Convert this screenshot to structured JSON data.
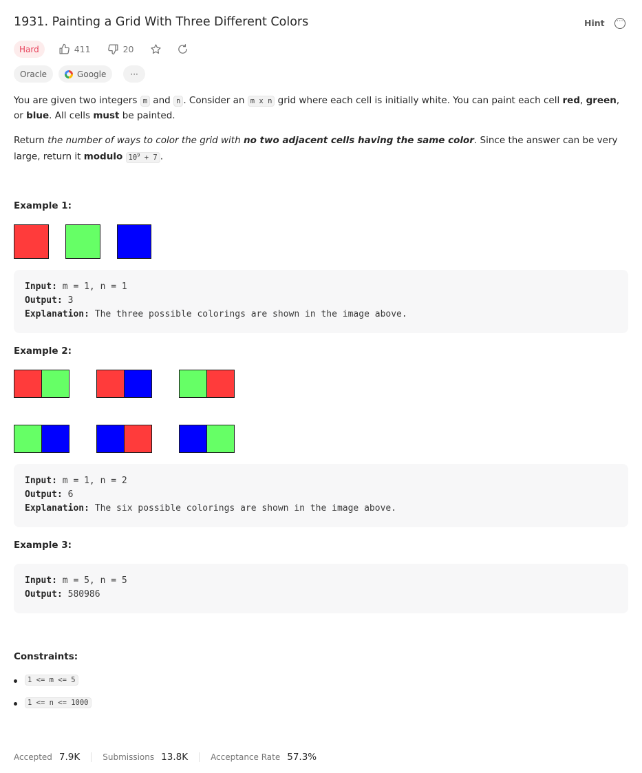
{
  "problem": {
    "title": "1931. Painting a Grid With Three Different Colors",
    "hint_label": "Hint",
    "more_label": "···",
    "difficulty": "Hard",
    "likes": "411",
    "dislikes": "20",
    "companies": [
      "Oracle",
      "Google"
    ],
    "companies_more": "···"
  },
  "description": {
    "p1_a": "You are given two integers ",
    "p1_m": "m",
    "p1_b": " and ",
    "p1_n": "n",
    "p1_c": ". Consider an ",
    "p1_mxn": "m x n",
    "p1_d": " grid where each cell is initially white. You can paint each cell ",
    "p1_red": "red",
    "p1_e": ", ",
    "p1_green": "green",
    "p1_f": ", or ",
    "p1_blue": "blue",
    "p1_g": ". All cells ",
    "p1_must": "must",
    "p1_h": " be painted.",
    "p2_a": "Return ",
    "p2_ital": "the number of ways to color the grid with ",
    "p2_bold": "no two adjacent cells having the same color",
    "p2_b": ". Since the answer can be very large, return it ",
    "p2_modulo": "modulo",
    "p2_code_base": "10",
    "p2_code_exp": "9",
    "p2_code_rest": " + 7",
    "p2_c": "."
  },
  "colors": {
    "red": "#ff3b3b",
    "green": "#66ff66",
    "blue": "#0000ff",
    "hard": "#e8455e"
  },
  "examples": [
    {
      "title": "Example 1:",
      "input_label": "Input:",
      "input": "m = 1, n = 1",
      "output_label": "Output:",
      "output": "3",
      "explanation_label": "Explanation:",
      "explanation": "The three possible colorings are shown in the image above."
    },
    {
      "title": "Example 2:",
      "input_label": "Input:",
      "input": "m = 1, n = 2",
      "output_label": "Output:",
      "output": "6",
      "explanation_label": "Explanation:",
      "explanation": "The six possible colorings are shown in the image above."
    },
    {
      "title": "Example 3:",
      "input_label": "Input:",
      "input": "m = 5, n = 5",
      "output_label": "Output:",
      "output": "580986"
    }
  ],
  "constraints": {
    "title": "Constraints:",
    "items": [
      "1 <= m <= 5",
      "1 <= n <= 1000"
    ]
  },
  "stats": {
    "accepted_label": "Accepted",
    "accepted": "7.9K",
    "submissions_label": "Submissions",
    "submissions": "13.8K",
    "rate_label": "Acceptance Rate",
    "rate": "57.3%"
  }
}
